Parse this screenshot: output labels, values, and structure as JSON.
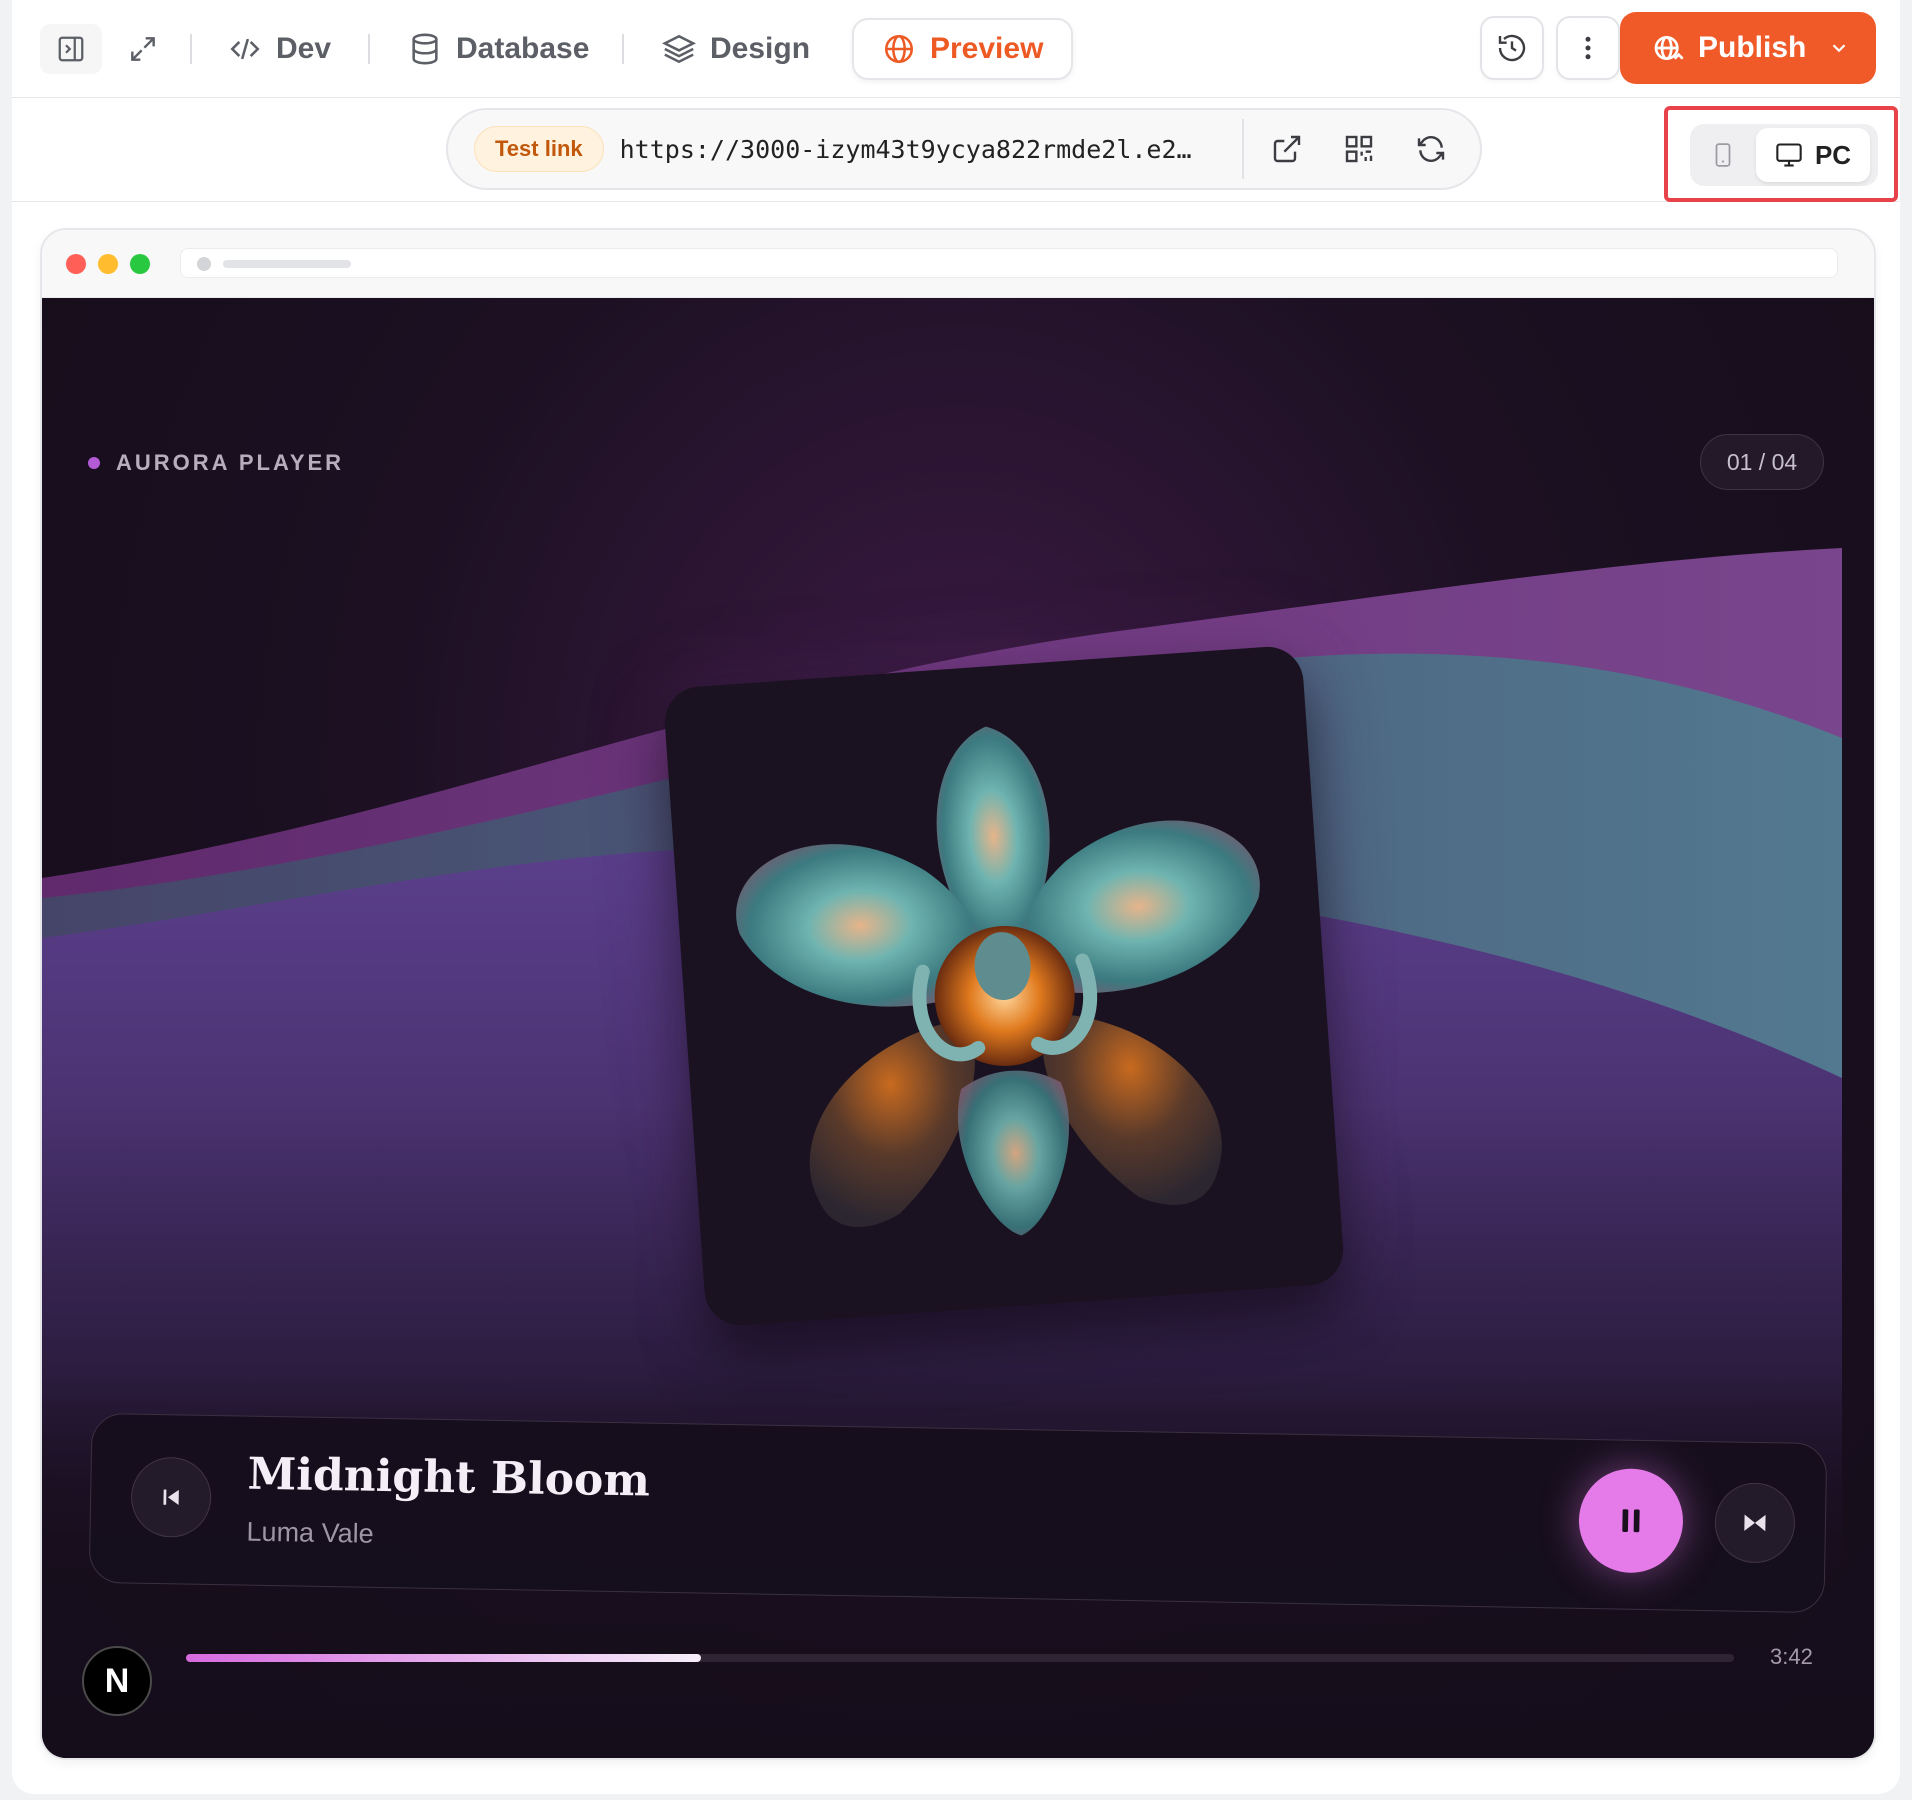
{
  "toolbar": {
    "tabs": [
      {
        "label": "Dev",
        "icon": "code-icon"
      },
      {
        "label": "Database",
        "icon": "database-icon"
      },
      {
        "label": "Design",
        "icon": "layers-icon"
      },
      {
        "label": "Preview",
        "icon": "globe-icon",
        "active": true
      }
    ],
    "publish_label": "Publish",
    "accent_color": "#f05a28"
  },
  "urlbar": {
    "test_link_label": "Test link",
    "url": "https://3000-izym43t9ycya822rmde2l.e2…"
  },
  "device_toggle": {
    "options": [
      {
        "label": "",
        "icon": "mobile-icon"
      },
      {
        "label": "PC",
        "icon": "monitor-icon",
        "selected": true
      }
    ]
  },
  "app": {
    "brand": "AURORA PLAYER",
    "counter": "01 / 04",
    "track": {
      "title": "Midnight Bloom",
      "artist": "Luma Vale",
      "duration": "3:42",
      "progress": 0.333
    },
    "badge_letter": "N",
    "play_color": "#e57ae9"
  }
}
